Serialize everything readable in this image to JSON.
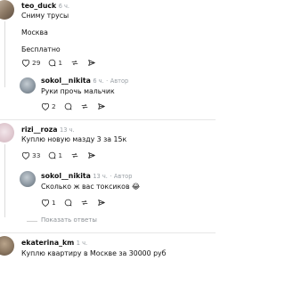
{
  "comments": [
    {
      "username": "teo_duck",
      "time": "6 ч.",
      "lines": [
        "Сниму трусы",
        "Москва",
        "Бесплатно"
      ],
      "likes": "29",
      "replies": "1"
    },
    {
      "username": "sokol__nikita",
      "time": "6 ч.",
      "author_badge": "Автор",
      "lines": [
        "Руки прочь мальчик"
      ],
      "likes": "2"
    },
    {
      "username": "rizi__roza",
      "time": "13 ч.",
      "lines": [
        "Куплю новую мазду 3 за 15к"
      ],
      "likes": "33",
      "replies": "1"
    },
    {
      "username": "sokol__nikita",
      "time": "13 ч.",
      "author_badge": "Автор",
      "lines": [
        "Сколько ж вас токсиков 😂"
      ],
      "likes": "1"
    },
    {
      "username": "ekaterina_km",
      "time": "1 ч.",
      "lines": [
        "Куплю квартиру в Москве за 30000 руб"
      ]
    }
  ],
  "show_replies_label": "Показать ответы",
  "separator": "·",
  "icons": [
    "heart-icon",
    "comment-icon",
    "repost-icon",
    "share-icon"
  ]
}
